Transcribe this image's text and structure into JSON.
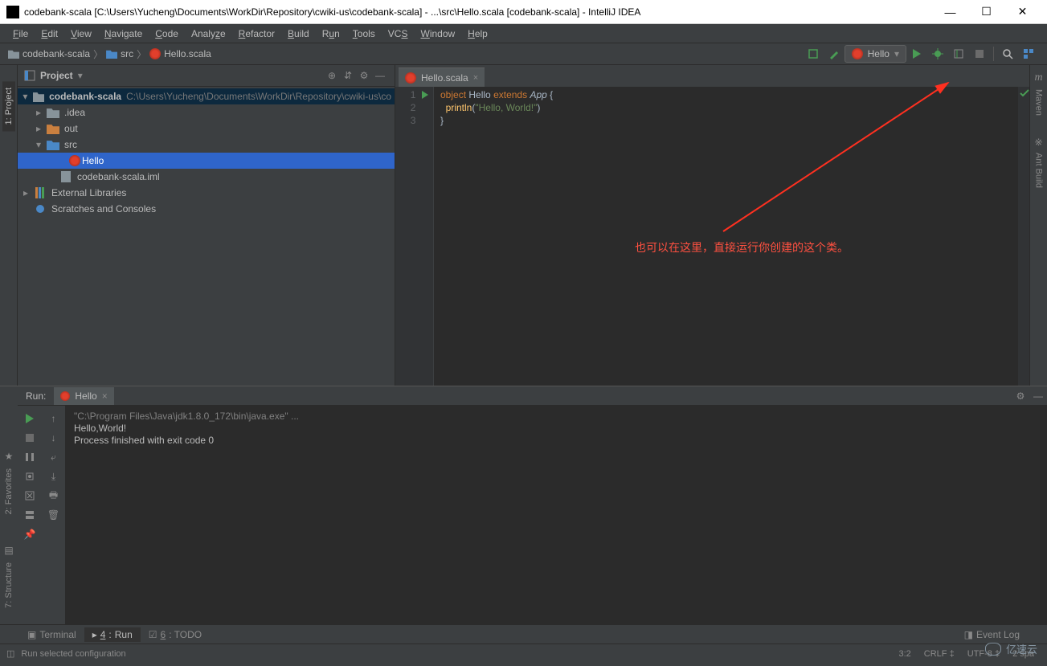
{
  "titlebar": {
    "title": "codebank-scala [C:\\Users\\Yucheng\\Documents\\WorkDir\\Repository\\cwiki-us\\codebank-scala] - ...\\src\\Hello.scala [codebank-scala] - IntelliJ IDEA"
  },
  "menu": [
    "File",
    "Edit",
    "View",
    "Navigate",
    "Code",
    "Analyze",
    "Refactor",
    "Build",
    "Run",
    "Tools",
    "VCS",
    "Window",
    "Help"
  ],
  "breadcrumb": [
    "codebank-scala",
    "src",
    "Hello.scala"
  ],
  "run_config": "Hello",
  "project_panel": {
    "title": "Project",
    "tree": {
      "root": {
        "label": "codebank-scala",
        "hint": "C:\\Users\\Yucheng\\Documents\\WorkDir\\Repository\\cwiki-us\\co"
      },
      "idea": ".idea",
      "out": "out",
      "src": "src",
      "hello": "Hello",
      "iml": "codebank-scala.iml",
      "ext": "External Libraries",
      "scratch": "Scratches and Consoles"
    }
  },
  "editor": {
    "tab": "Hello.scala",
    "lines": [
      "1",
      "2",
      "3"
    ],
    "code": {
      "l1_kw1": "object",
      "l1_cls": "Hello",
      "l1_kw2": "extends",
      "l1_app": "App",
      "l1_brace": "{",
      "l2_fn": "println",
      "l2_open": "(",
      "l2_str": "\"Hello, World!\"",
      "l2_close": ")",
      "l3_brace": "}"
    }
  },
  "annotation": "也可以在这里，直接运行你创建的这个类。",
  "right": {
    "maven": "Maven",
    "ant": "Ant Build"
  },
  "left": {
    "project": "1: Project",
    "favorites": "2: Favorites",
    "structure": "7: Structure"
  },
  "run_panel": {
    "label": "Run:",
    "tab": "Hello",
    "output": {
      "cmd": "\"C:\\Program Files\\Java\\jdk1.8.0_172\\bin\\java.exe\" ...",
      "line1": "Hello,World!",
      "line2": "",
      "line3": "Process finished with exit code 0"
    }
  },
  "tool_buttons": {
    "terminal": "Terminal",
    "run": "4: Run",
    "todo": "6: TODO",
    "event_log": "Event Log"
  },
  "statusbar": {
    "msg": "Run selected configuration",
    "pos": "3:2",
    "crlf": "CRLF",
    "enc": "UTF-8",
    "indent": "2 spa"
  },
  "watermark": "亿速云"
}
